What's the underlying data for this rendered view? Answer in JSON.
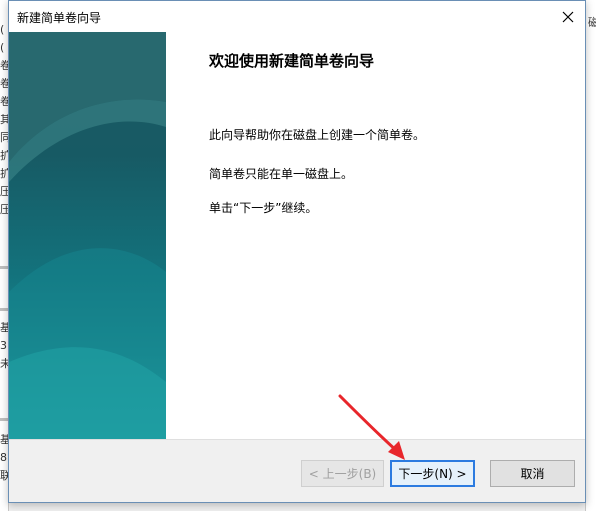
{
  "dialog": {
    "title": "新建简单卷向导",
    "close_icon": "close-icon"
  },
  "welcome": {
    "heading": "欢迎使用新建简单卷向导",
    "line1": "此向导帮助你在磁盘上创建一个简单卷。",
    "line2": "简单卷只能在单一磁盘上。",
    "line3": "单击“下一步”继续。"
  },
  "buttons": {
    "back": "< 上一步(B)",
    "next": "下一步(N) >",
    "cancel": "取消"
  },
  "background": {
    "right_char": "磁",
    "left_chars": [
      "(",
      "(",
      "卷",
      "卷",
      "卷",
      "其",
      "同",
      "扩",
      "扩",
      "压",
      "压",
      "基",
      "3",
      "未",
      "基",
      "8",
      "联"
    ]
  },
  "colors": {
    "banner_top": "#1d5a63",
    "banner_bottom": "#20a2a5",
    "focus_border": "#2c7be0",
    "annotation_arrow": "#e8262b"
  }
}
